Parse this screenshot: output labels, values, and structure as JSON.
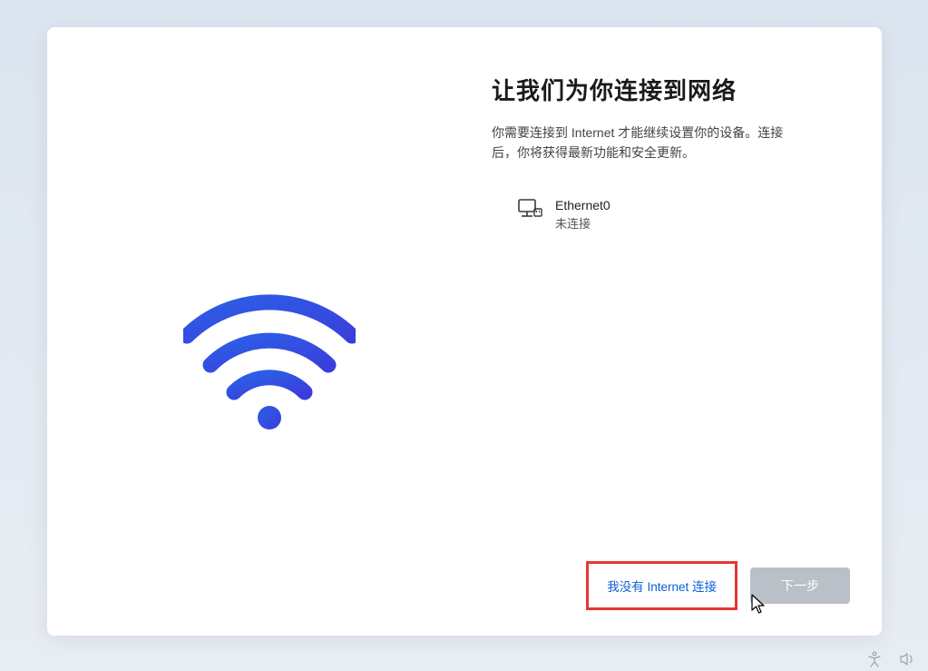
{
  "main": {
    "title": "让我们为你连接到网络",
    "subtitle": "你需要连接到 Internet 才能继续设置你的设备。连接后，你将获得最新功能和安全更新。"
  },
  "network": {
    "name": "Ethernet0",
    "status": "未连接"
  },
  "buttons": {
    "no_internet": "我没有 Internet 连接",
    "next": "下一步"
  }
}
